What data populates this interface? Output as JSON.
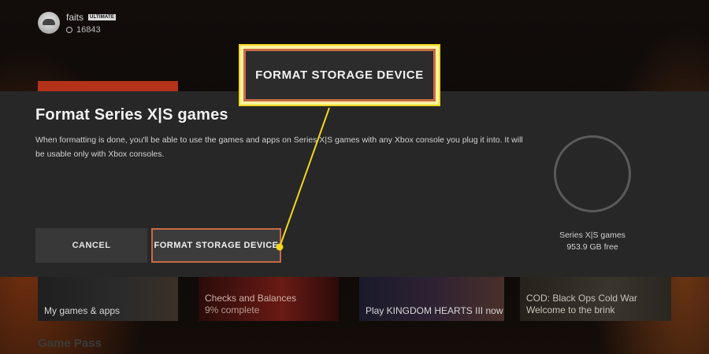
{
  "profile": {
    "gamertag": "faits",
    "badge": "ULTIMATE",
    "gamerscore": "16843"
  },
  "home_tiles": [
    {
      "line1": "My games & apps",
      "line2": ""
    },
    {
      "line1": "Checks and Balances",
      "line2": "9% complete"
    },
    {
      "line1": "Play KINGDOM HEARTS III now",
      "line2": ""
    },
    {
      "line1": "COD: Black Ops Cold War",
      "line2": "Welcome to the brink"
    }
  ],
  "section_label": "Game Pass",
  "dialog": {
    "title": "Format Series X|S games",
    "body": "When formatting is done, you'll be able to use the games and apps on Series X|S games with any Xbox console you plug it into. It will be usable only with Xbox consoles.",
    "cancel_label": "CANCEL",
    "format_label": "FORMAT STORAGE DEVICE",
    "storage_name": "Series X|S games",
    "storage_free": "953.9 GB free"
  },
  "callout": {
    "label": "FORMAT STORAGE DEVICE",
    "highlight_color": "#f2d71c"
  },
  "colors": {
    "dialog_bg": "#272727",
    "focus_border": "#c96a46",
    "accent_orange": "#b5321a"
  }
}
